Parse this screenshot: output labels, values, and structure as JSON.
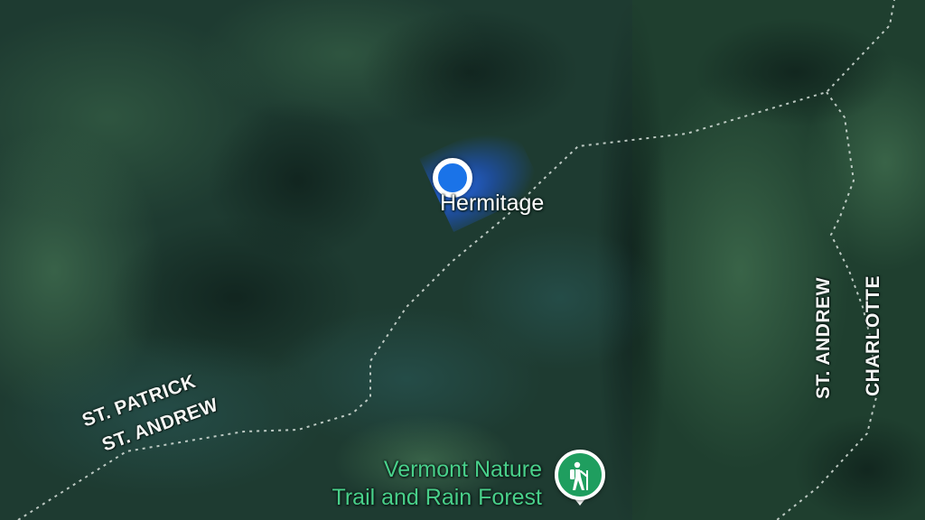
{
  "map": {
    "type": "satellite",
    "colors": {
      "terrain": "#1d3a30",
      "boundary": "#d8e2dc",
      "poi": "#49d08a",
      "location": "#1a73e8"
    }
  },
  "place_label": "Hermitage",
  "parish_labels": {
    "st_patrick": "ST. PATRICK",
    "st_andrew_left": "ST. ANDREW",
    "st_andrew_right": "ST. ANDREW",
    "charlotte": "CHARLOTTE"
  },
  "poi": {
    "name_line1": "Vermont Nature",
    "name_line2": "Trail and Rain Forest",
    "icon": "hiker-icon"
  },
  "user_location": {
    "icon": "current-location-dot"
  }
}
